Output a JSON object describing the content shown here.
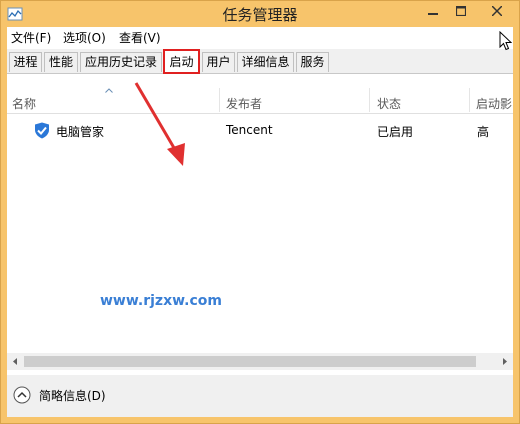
{
  "window": {
    "title": "任务管理器"
  },
  "menu": [
    {
      "label": "文件(F)"
    },
    {
      "label": "选项(O)"
    },
    {
      "label": "查看(V)"
    }
  ],
  "tabs": [
    {
      "label": "进程"
    },
    {
      "label": "性能"
    },
    {
      "label": "应用历史记录"
    },
    {
      "label": "启动",
      "active": true
    },
    {
      "label": "用户"
    },
    {
      "label": "详细信息"
    },
    {
      "label": "服务"
    }
  ],
  "table": {
    "columns": [
      "名称",
      "发布者",
      "状态",
      "启动影"
    ],
    "rows": [
      {
        "name": "电脑管家",
        "publisher": "Tencent",
        "status": "已启用",
        "impact": "高"
      }
    ]
  },
  "watermark": "www.rjzxw.com",
  "footer": {
    "label": "简略信息(D)"
  },
  "colors": {
    "titlebar": "#f7c46b",
    "highlight": "#e02020",
    "annotation_arrow": "#e03030"
  }
}
